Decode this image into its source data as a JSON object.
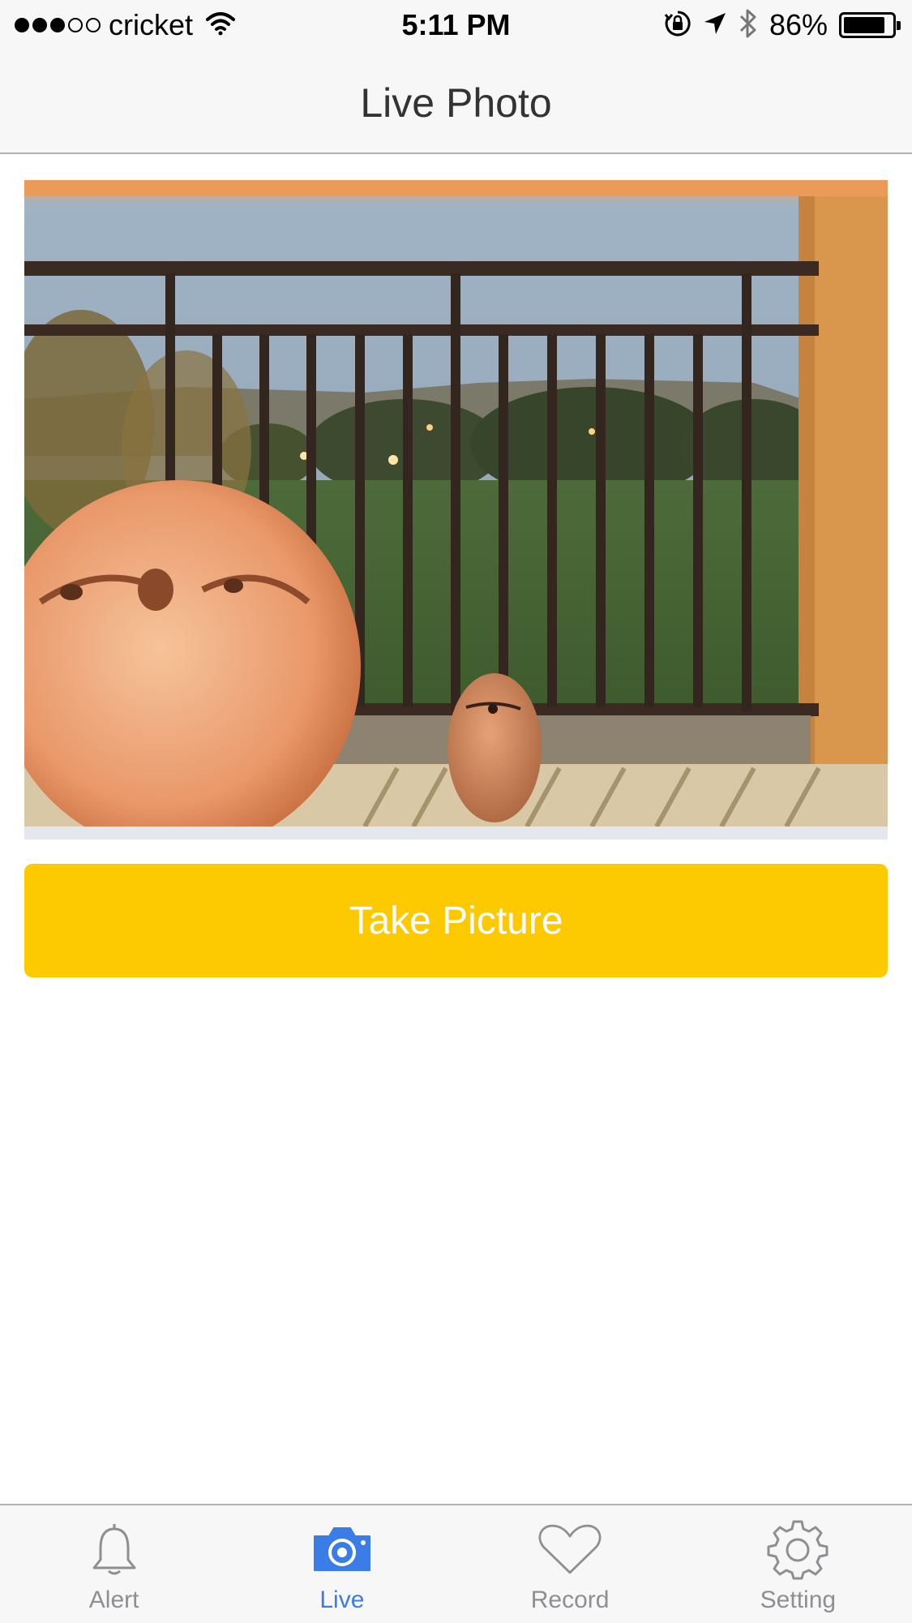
{
  "status_bar": {
    "carrier": "cricket",
    "time": "5:11 PM",
    "battery_percent": "86%",
    "battery_level": 0.86,
    "signal_bars_filled": 3,
    "signal_bars_total": 5,
    "icons": [
      "wifi-icon",
      "rotation-lock-icon",
      "location-arrow-icon",
      "bluetooth-icon",
      "battery-icon"
    ]
  },
  "nav": {
    "title": "Live Photo"
  },
  "photo": {
    "description_icon": "live-camera-feed"
  },
  "actions": {
    "take_picture_label": "Take Picture",
    "take_picture_color": "#fdc900"
  },
  "tabs": [
    {
      "label": "Alert",
      "icon": "bell-icon",
      "active": false
    },
    {
      "label": "Live",
      "icon": "camera-icon",
      "active": true
    },
    {
      "label": "Record",
      "icon": "heart-icon",
      "active": false
    },
    {
      "label": "Setting",
      "icon": "gear-icon",
      "active": false
    }
  ],
  "colors": {
    "active_tab": "#3a7de6",
    "inactive_tab": "#8e8e93",
    "accent_button": "#fdc900"
  }
}
